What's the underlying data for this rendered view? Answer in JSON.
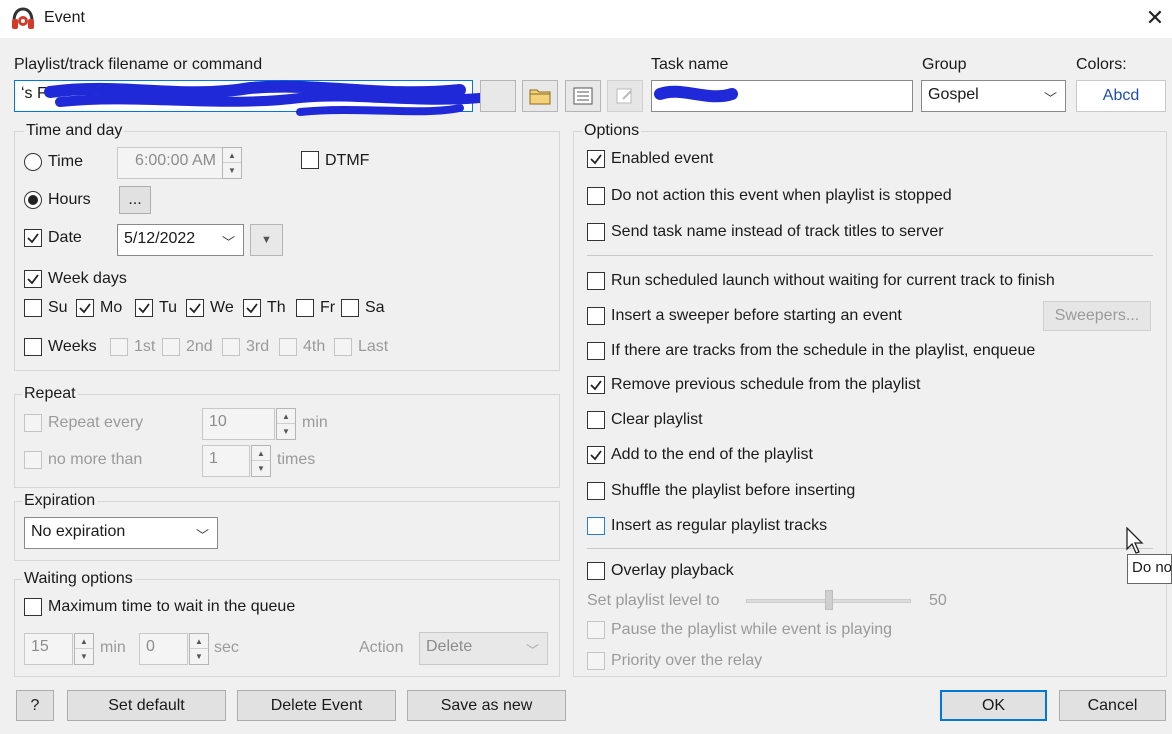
{
  "window": {
    "title": "Event",
    "close_icon": "close-icon"
  },
  "top": {
    "playlist_label": "Playlist/track filename or command",
    "playlist_value": "ʻs F",
    "task_label": "Task name",
    "task_value": "",
    "group_label": "Group",
    "group_value": "Gospel",
    "colors_label": "Colors:",
    "colors_value": "Abcd"
  },
  "time_and_day": {
    "title": "Time and day",
    "time_label": "Time",
    "time_value": "6:00:00 AM",
    "dtmf_label": "DTMF",
    "hours_label": "Hours",
    "hours_button": "...",
    "date_label": "Date",
    "date_value": "5/12/2022",
    "weekdays_label": "Week days",
    "days": [
      {
        "label": "Su",
        "checked": false
      },
      {
        "label": "Mo",
        "checked": true
      },
      {
        "label": "Tu",
        "checked": true
      },
      {
        "label": "We",
        "checked": true
      },
      {
        "label": "Th",
        "checked": true
      },
      {
        "label": "Fr",
        "checked": false
      },
      {
        "label": "Sa",
        "checked": false
      }
    ],
    "weeks_label": "Weeks",
    "weeks": [
      "1st",
      "2nd",
      "3rd",
      "4th",
      "Last"
    ]
  },
  "repeat": {
    "title": "Repeat",
    "repeat_every_label": "Repeat every",
    "repeat_every_value": "10",
    "repeat_unit": "min",
    "no_more_label": "no more than",
    "no_more_value": "1",
    "no_more_unit": "times"
  },
  "expiration": {
    "title": "Expiration",
    "value": "No expiration"
  },
  "waiting": {
    "title": "Waiting options",
    "max_time_label": "Maximum time to wait in the queue",
    "min_value": "15",
    "min_label": "min",
    "sec_value": "0",
    "sec_label": "sec",
    "action_label": "Action",
    "action_value": "Delete"
  },
  "options": {
    "title": "Options",
    "enabled": "Enabled event",
    "no_action_stopped": "Do not action this event when playlist is stopped",
    "send_task_name": "Send task name instead of track titles to server",
    "run_without_waiting": "Run scheduled launch without waiting for current track to finish",
    "insert_sweeper": "Insert a sweeper before starting an event",
    "sweepers_button": "Sweepers...",
    "enqueue": "If there are tracks from the schedule in the playlist, enqueue",
    "remove_previous": "Remove previous schedule from the playlist",
    "clear_playlist": "Clear playlist",
    "add_to_end": "Add to the end of the playlist",
    "shuffle": "Shuffle the playlist before inserting",
    "insert_regular": "Insert as regular playlist tracks",
    "overlay": "Overlay playback",
    "set_level_label": "Set playlist level to",
    "level_value": "50",
    "pause_playlist": "Pause the playlist while event is playing",
    "priority": "Priority over the relay"
  },
  "footer": {
    "help": "?",
    "set_default": "Set default",
    "delete_event": "Delete Event",
    "save_as_new": "Save as new",
    "ok": "OK",
    "cancel": "Cancel"
  },
  "tooltip": "Do no"
}
